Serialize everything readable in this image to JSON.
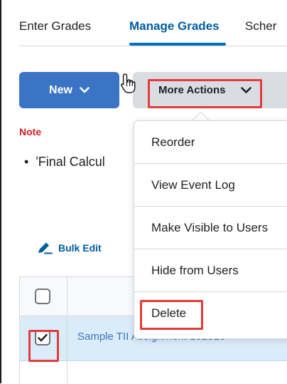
{
  "tabs": {
    "enter": "Enter Grades",
    "manage": "Manage Grades",
    "schemes": "Scher"
  },
  "toolbar": {
    "new_label": "New",
    "more_actions_label": "More Actions"
  },
  "note": {
    "label": "Note",
    "bullet_text": "'Final Calcul"
  },
  "bulk_edit": {
    "label": "Bulk Edit"
  },
  "table": {
    "row_1_name": "Sample TII Assignment 102823",
    "row_1_checked": true
  },
  "menu": {
    "items": [
      {
        "label": "Reorder"
      },
      {
        "label": "View Event Log"
      },
      {
        "label": "Make Visible to Users"
      },
      {
        "label": "Hide from Users"
      },
      {
        "label": "Delete"
      }
    ]
  },
  "colors": {
    "accent_blue": "#3b74c4",
    "tab_active": "#005c9e",
    "note_red": "#cd2026",
    "highlight_red": "#e23b3b",
    "selected_row": "#dbecf9"
  },
  "icons": {
    "new_chevron": "chevron-down-icon",
    "more_chevron": "chevron-down-icon",
    "bulk_edit": "pencil-icon",
    "cursor": "hand-pointer-icon",
    "checkbox": "checkmark-icon"
  }
}
